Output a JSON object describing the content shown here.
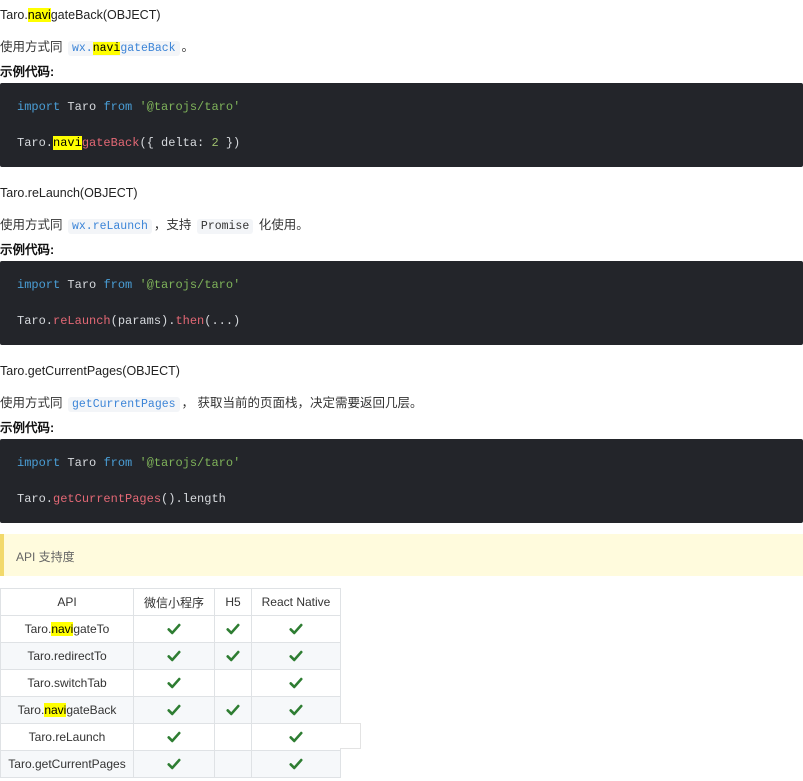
{
  "sections": [
    {
      "heading": {
        "pre": "Taro.",
        "hl": "navi",
        "post": "gateBack(OBJECT)"
      },
      "desc": {
        "pre": "使用方式同",
        "code_pre": "wx.",
        "code_hl": "navi",
        "code_post": "gateBack",
        "post": "。"
      },
      "example_label": "示例代码:",
      "code": {
        "l1": {
          "kw1": "import",
          "ident": " Taro ",
          "kw2": "from",
          "str": " '@tarojs/taro'"
        },
        "l2": {
          "obj": "Taro.",
          "hl": "navi",
          "fn": "gateBack",
          "rest_pre": "({ delta: ",
          "num": "2",
          "rest_post": " })"
        }
      }
    },
    {
      "heading": "Taro.reLaunch(OBJECT)",
      "desc": {
        "pre": "使用方式同",
        "code1": "wx.reLaunch",
        "mid": "，支持",
        "code2": "Promise",
        "post": "化使用。"
      },
      "example_label": "示例代码:",
      "code": {
        "l1": {
          "kw1": "import",
          "ident": " Taro ",
          "kw2": "from",
          "str": " '@tarojs/taro'"
        },
        "l2": {
          "obj": "Taro.",
          "fn1": "reLaunch",
          "mid": "(params).",
          "fn2": "then",
          "rest": "(...)"
        }
      }
    },
    {
      "heading": "Taro.getCurrentPages(OBJECT)",
      "desc": {
        "pre": "使用方式同",
        "code1": "getCurrentPages",
        "post": "，  获取当前的页面栈，决定需要返回几层。"
      },
      "example_label": "示例代码:",
      "code": {
        "l1": {
          "kw1": "import",
          "ident": " Taro ",
          "kw2": "from",
          "str": " '@tarojs/taro'"
        },
        "l2": {
          "obj": "Taro.",
          "fn": "getCurrentPages",
          "rest": "().length"
        }
      }
    }
  ],
  "tip": "API 支持度",
  "table": {
    "headers": [
      "API",
      "微信小程序",
      "H5",
      "React Native"
    ],
    "rows": [
      {
        "api_pre": "Taro.",
        "api_hl": "navi",
        "api_post": "gateTo",
        "wx": true,
        "h5": true,
        "rn": true
      },
      {
        "api_pre": "Taro.redirectTo",
        "api_hl": "",
        "api_post": "",
        "wx": true,
        "h5": true,
        "rn": true
      },
      {
        "api_pre": "Taro.switchTab",
        "api_hl": "",
        "api_post": "",
        "wx": true,
        "h5": false,
        "rn": true
      },
      {
        "api_pre": "Taro.",
        "api_hl": "navi",
        "api_post": "gateBack",
        "wx": true,
        "h5": true,
        "rn": true
      },
      {
        "api_pre": "Taro.reLaunch",
        "api_hl": "",
        "api_post": "",
        "wx": true,
        "h5": false,
        "rn": true
      },
      {
        "api_pre": "Taro.getCurrentPages",
        "api_hl": "",
        "api_post": "",
        "wx": true,
        "h5": false,
        "rn": true
      }
    ]
  },
  "colors": {
    "check": "#2e7d32",
    "code_bg": "#23252a",
    "highlight": "#ffff00",
    "tip_bg": "#fffbdd"
  },
  "icons": {
    "check": "checkmark-icon"
  }
}
